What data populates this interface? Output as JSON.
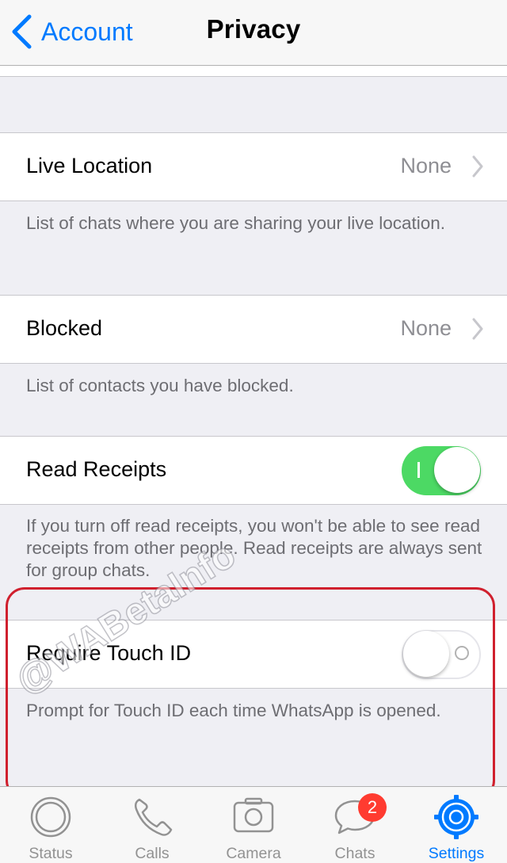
{
  "nav": {
    "back_label": "Account",
    "title": "Privacy"
  },
  "rows": {
    "live_location": {
      "label": "Live Location",
      "value": "None",
      "footer": "List of chats where you are sharing your live location."
    },
    "blocked": {
      "label": "Blocked",
      "value": "None",
      "footer": "List of contacts you have blocked."
    },
    "read_receipts": {
      "label": "Read Receipts",
      "enabled": true,
      "footer": "If you turn off read receipts, you won't be able to see read receipts from other people. Read receipts are always sent for group chats."
    },
    "touch_id": {
      "label": "Require Touch ID",
      "enabled": false,
      "footer": "Prompt for Touch ID each time WhatsApp is opened."
    }
  },
  "watermark": "@WABetaInfo",
  "tabs": [
    {
      "label": "Status",
      "icon": "status-icon"
    },
    {
      "label": "Calls",
      "icon": "phone-icon"
    },
    {
      "label": "Camera",
      "icon": "camera-icon"
    },
    {
      "label": "Chats",
      "icon": "chat-bubble-icon",
      "badge": "2"
    },
    {
      "label": "Settings",
      "icon": "gear-icon",
      "active": true
    }
  ],
  "colors": {
    "accent": "#007aff",
    "toggle_on": "#4cd964",
    "badge": "#ff3b30",
    "highlight": "#d0202e"
  }
}
